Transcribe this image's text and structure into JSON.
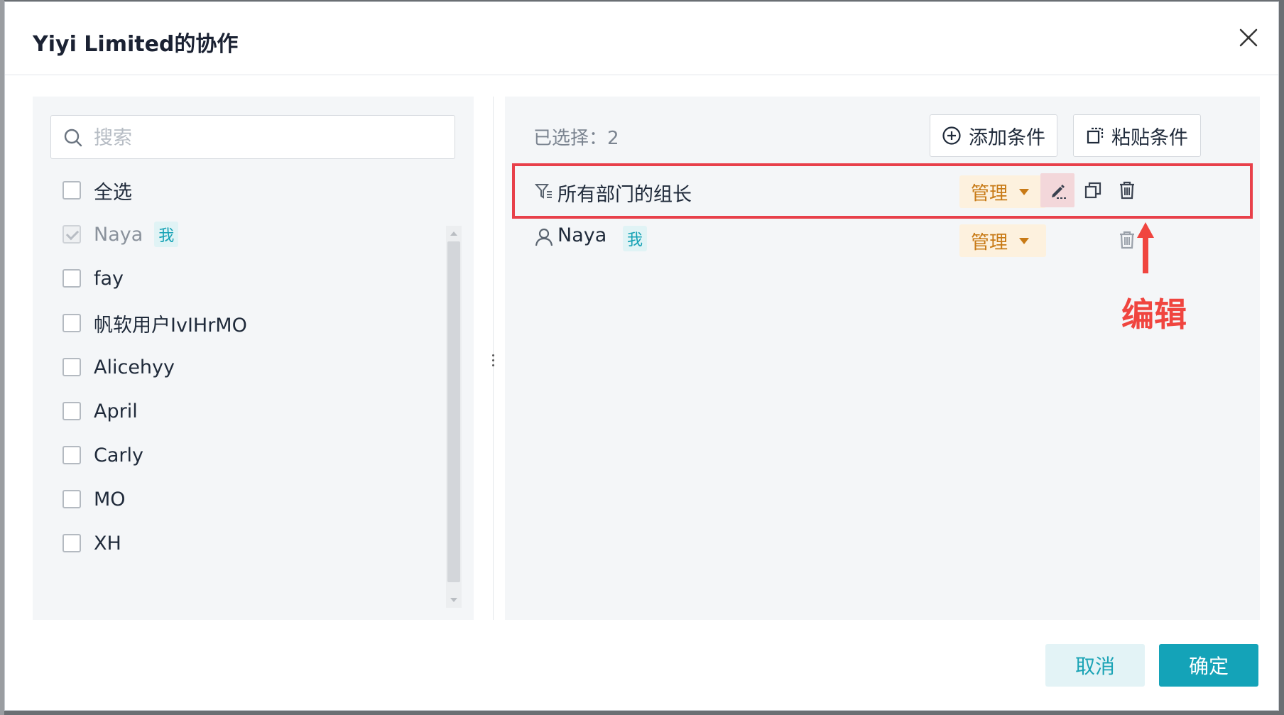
{
  "dialog": {
    "title": "Yiyi Limited的协作"
  },
  "member_list": {
    "search_placeholder": "搜索",
    "select_all_label": "全选",
    "me_badge": "我",
    "items": [
      {
        "label": "Naya",
        "checked": true,
        "disabled": true,
        "is_me": true
      },
      {
        "label": "fay",
        "checked": false
      },
      {
        "label": "帆软用户IvIHrMO",
        "checked": false
      },
      {
        "label": "Alicehyy",
        "checked": false
      },
      {
        "label": "April",
        "checked": false
      },
      {
        "label": "Carly",
        "checked": false
      },
      {
        "label": "MO",
        "checked": false
      },
      {
        "label": "XH",
        "checked": false
      }
    ]
  },
  "selected_panel": {
    "count_label": "已选择：2",
    "add_condition_label": "添加条件",
    "paste_condition_label": "粘贴条件",
    "rows": [
      {
        "label": "所有部门的组长",
        "permission": "管理",
        "type": "condition"
      },
      {
        "label": "Naya",
        "permission": "管理",
        "type": "user",
        "is_me": true
      }
    ]
  },
  "annotation": {
    "text": "编辑",
    "color": "#f0453f"
  },
  "footer": {
    "cancel_label": "取消",
    "confirm_label": "确定"
  },
  "colors": {
    "accent": "#14a3b8",
    "permission_text": "#c87a16",
    "highlight_border": "#e8404a"
  }
}
